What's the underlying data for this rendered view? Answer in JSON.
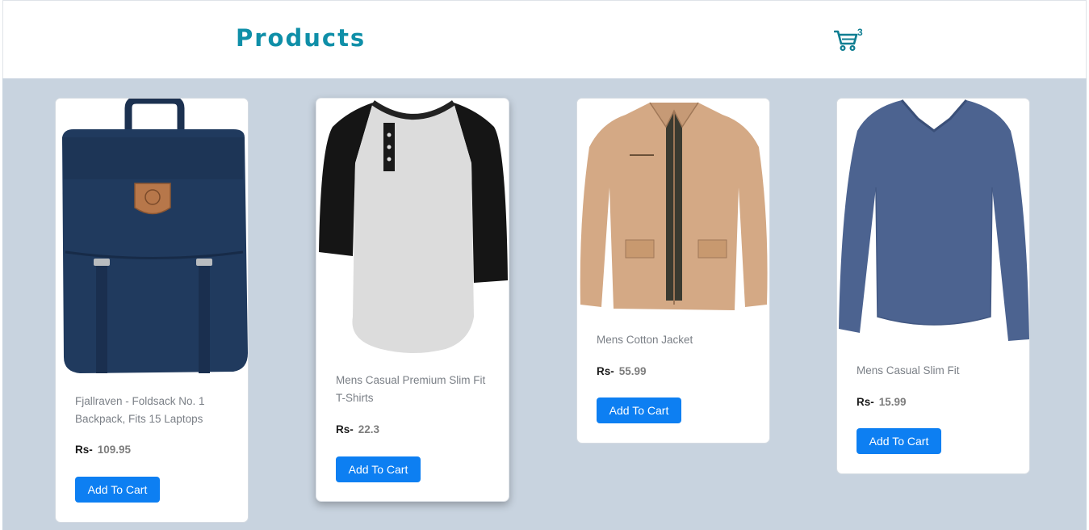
{
  "header": {
    "title": "Products",
    "cart_count": "3"
  },
  "colors": {
    "accent": "#0f8fa8",
    "background": "#c8d3df",
    "button": "#0d7ff2"
  },
  "products": [
    {
      "name": "Fjallraven - Foldsack No. 1 Backpack, Fits 15 Laptops",
      "currency": "Rs-",
      "price": "109.95",
      "button": "Add To Cart"
    },
    {
      "name": "Mens Casual Premium Slim Fit T-Shirts",
      "currency": "Rs-",
      "price": "22.3",
      "button": "Add To Cart"
    },
    {
      "name": "Mens Cotton Jacket",
      "currency": "Rs-",
      "price": "55.99",
      "button": "Add To Cart"
    },
    {
      "name": "Mens Casual Slim Fit",
      "currency": "Rs-",
      "price": "15.99",
      "button": "Add To Cart"
    }
  ]
}
